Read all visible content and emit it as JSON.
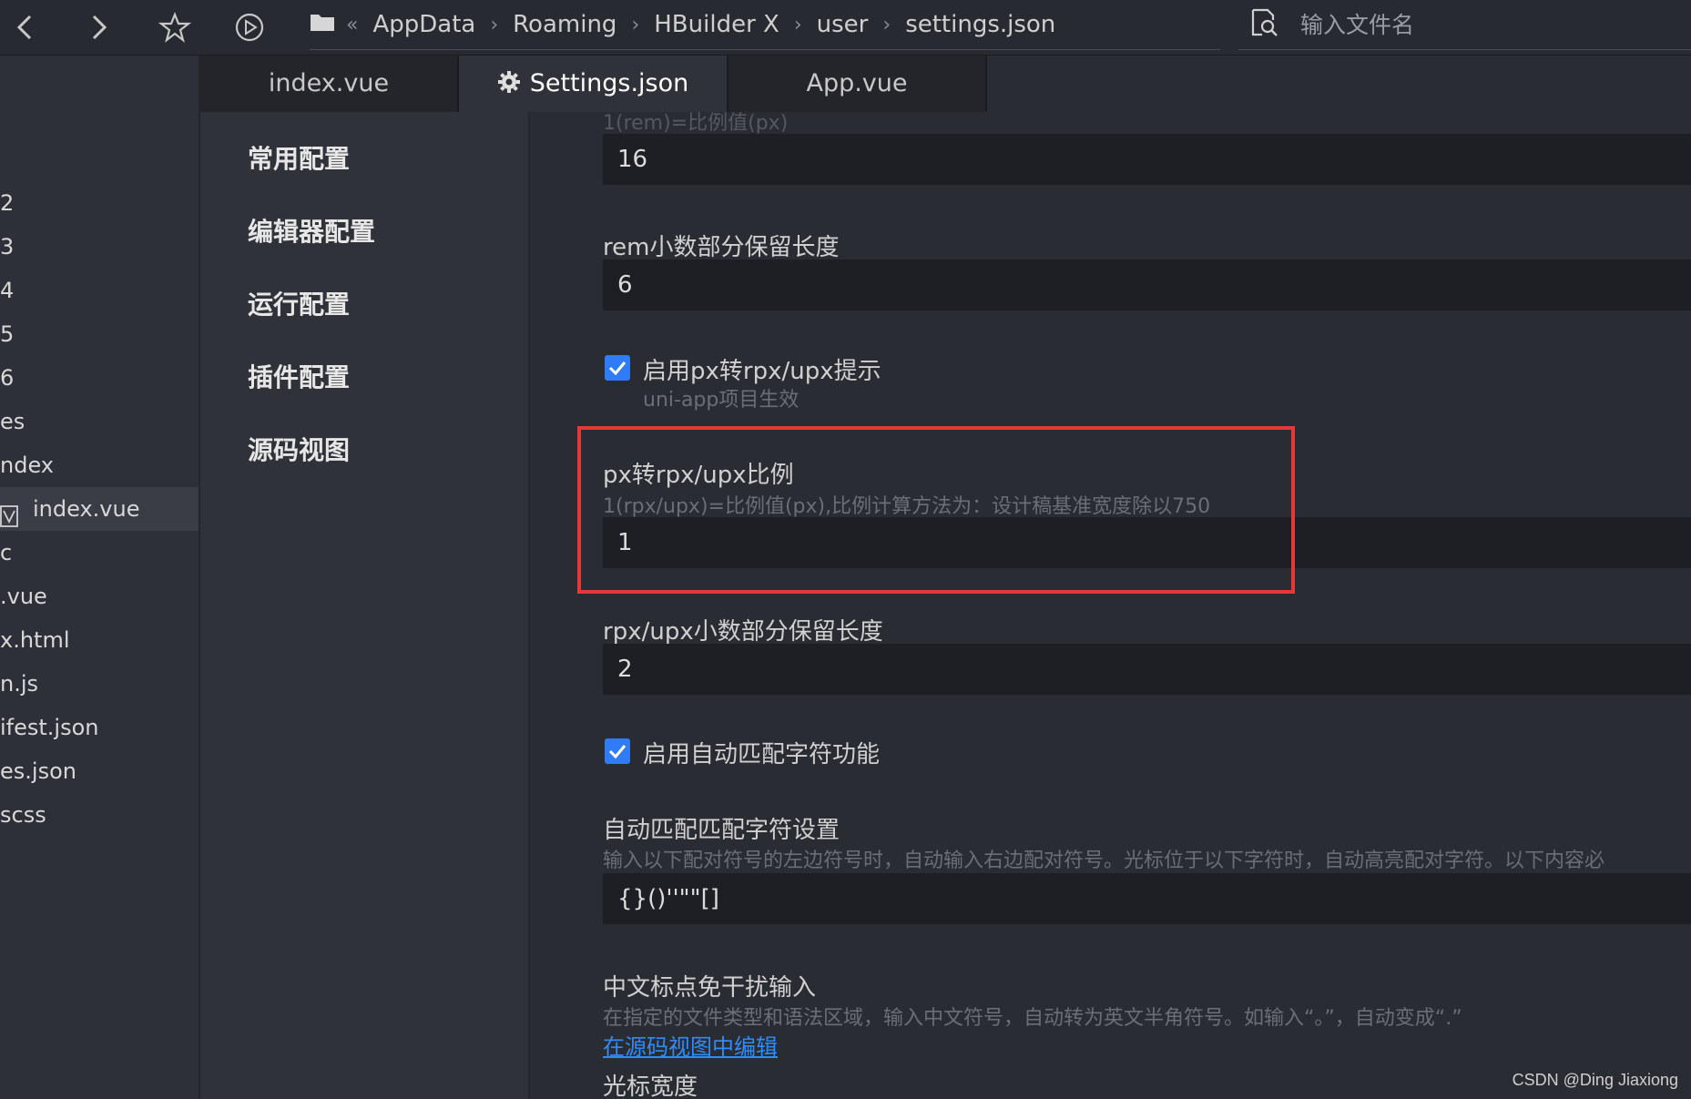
{
  "toolbar": {
    "back_icon": "chevron-left-icon",
    "forward_icon": "chevron-right-icon",
    "star_icon": "star-icon",
    "play_icon": "play-icon"
  },
  "breadcrumb": {
    "overflow": "«",
    "items": [
      "AppData",
      "Roaming",
      "HBuilder X",
      "user",
      "settings.json"
    ]
  },
  "search": {
    "placeholder": "输入文件名"
  },
  "filetree": {
    "items": [
      {
        "label": "2"
      },
      {
        "label": "3"
      },
      {
        "label": "4"
      },
      {
        "label": "5"
      },
      {
        "label": "6"
      },
      {
        "label": "es"
      },
      {
        "label": "ndex"
      },
      {
        "label": "index.vue",
        "active": true
      },
      {
        "label": "c"
      },
      {
        "label": ".vue"
      },
      {
        "label": "x.html"
      },
      {
        "label": "n.js"
      },
      {
        "label": "ifest.json"
      },
      {
        "label": "es.json"
      },
      {
        "label": "scss"
      }
    ]
  },
  "tabs": [
    {
      "label": "index.vue"
    },
    {
      "label": "Settings.json",
      "active": true
    },
    {
      "label": "App.vue"
    }
  ],
  "nav": {
    "items": [
      "常用配置",
      "编辑器配置",
      "运行配置",
      "插件配置",
      "源码视图"
    ]
  },
  "settings": {
    "rem_ratio": {
      "desc": "1(rem)=比例值(px)",
      "value": "16"
    },
    "rem_decimal": {
      "label": "rem小数部分保留长度",
      "value": "6"
    },
    "px_hint": {
      "label": "启用px转rpx/upx提示",
      "desc": "uni-app项目生效",
      "checked": true
    },
    "rpx_ratio": {
      "label": "px转rpx/upx比例",
      "desc": "1(rpx/upx)=比例值(px),比例计算方法为：设计稿基准宽度除以750",
      "value": "1"
    },
    "rpx_decimal": {
      "label": "rpx/upx小数部分保留长度",
      "value": "2"
    },
    "auto_match": {
      "label": "启用自动匹配字符功能",
      "checked": true
    },
    "match_chars": {
      "label": "自动匹配匹配字符设置",
      "desc": "输入以下配对符号的左边符号时，自动输入右边配对符号。光标位于以下字符时，自动高亮配对字符。以下内容必",
      "value": "{}()''\"\"[]"
    },
    "cn_punct": {
      "label": "中文标点免干扰输入",
      "desc": "在指定的文件类型和语法区域，输入中文符号，自动转为英文半角符号。如输入“。”，自动变成“.”",
      "link": "在源码视图中编辑"
    },
    "cursor_width": {
      "label": "光标宽度"
    }
  },
  "watermark": "CSDN @Ding Jiaxiong",
  "colors": {
    "accent": "#2f7cf6",
    "highlight_box": "#e53939",
    "link": "#2f8cf6"
  }
}
